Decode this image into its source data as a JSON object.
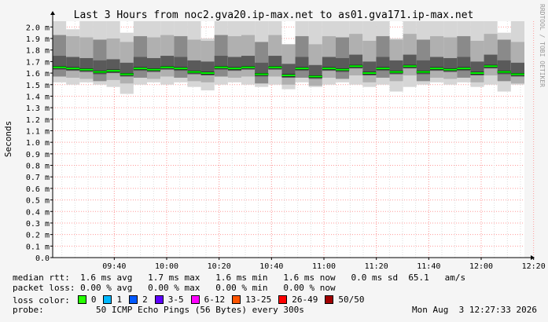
{
  "chart_data": {
    "type": "line",
    "title": "Last 3 Hours from noc2.gva20.ip-max.net to as01.gva171.ip-max.net",
    "ylabel": "Seconds",
    "xlabel": "",
    "watermark": "RRDTOOL / TOBI OETIKER",
    "ylim": [
      0,
      2.05
    ],
    "y_tick_labels": [
      "0.0",
      "0.1 m",
      "0.2 m",
      "0.3 m",
      "0.4 m",
      "0.5 m",
      "0.6 m",
      "0.7 m",
      "0.8 m",
      "0.9 m",
      "1.0 m",
      "1.1 m",
      "1.2 m",
      "1.3 m",
      "1.4 m",
      "1.5 m",
      "1.6 m",
      "1.7 m",
      "1.8 m",
      "1.9 m",
      "2.0 m"
    ],
    "x_tick_labels": [
      "09:40",
      "10:00",
      "10:20",
      "10:40",
      "11:00",
      "11:20",
      "11:40",
      "12:00",
      "12:20"
    ],
    "series": [
      {
        "name": "median rtt",
        "color": "#00ff00",
        "values": [
          1.65,
          1.64,
          1.63,
          1.61,
          1.62,
          1.59,
          1.64,
          1.63,
          1.65,
          1.64,
          1.61,
          1.6,
          1.65,
          1.64,
          1.65,
          1.59,
          1.65,
          1.58,
          1.64,
          1.57,
          1.64,
          1.63,
          1.66,
          1.6,
          1.64,
          1.61,
          1.66,
          1.61,
          1.64,
          1.63,
          1.64,
          1.6,
          1.66,
          1.61,
          1.59
        ]
      }
    ],
    "smoke_max": [
      2.05,
      1.98,
      2.05,
      2.05,
      2.05,
      1.95,
      2.05,
      2.05,
      2.05,
      2.05,
      2.05,
      1.9,
      2.05,
      2.05,
      2.05,
      2.05,
      2.05,
      1.85,
      2.05,
      2.05,
      2.05,
      2.05,
      2.05,
      2.05,
      2.05,
      1.9,
      2.05,
      2.05,
      2.05,
      2.05,
      2.05,
      2.05,
      2.05,
      1.95,
      2.05
    ],
    "smoke_min": [
      1.52,
      1.5,
      1.52,
      1.5,
      1.48,
      1.42,
      1.5,
      1.52,
      1.5,
      1.52,
      1.48,
      1.45,
      1.5,
      1.52,
      1.5,
      1.48,
      1.5,
      1.46,
      1.52,
      1.48,
      1.5,
      1.52,
      1.5,
      1.48,
      1.5,
      1.44,
      1.48,
      1.5,
      1.52,
      1.5,
      1.52,
      1.48,
      1.5,
      1.44,
      1.5
    ],
    "smoke_color": "#999999",
    "plot_background": "#ffffff",
    "grid_color": "#ff9999"
  },
  "stats": {
    "median_rtt": "median rtt:  1.6 ms avg   1.7 ms max   1.6 ms min   1.6 ms now   0.0 ms sd  65.1   am/s",
    "packet_loss": "packet loss: 0.00 % avg   0.00 % max   0.00 % min   0.00 % now"
  },
  "legend": {
    "label": "loss color:",
    "items": [
      {
        "label": "0",
        "color": "#26ff00"
      },
      {
        "label": "1",
        "color": "#00b8ff"
      },
      {
        "label": "2",
        "color": "#0059ff"
      },
      {
        "label": "3-5",
        "color": "#5e00ff"
      },
      {
        "label": "6-12",
        "color": "#ff00ff"
      },
      {
        "label": "13-25",
        "color": "#ff5500"
      },
      {
        "label": "26-49",
        "color": "#ff0000"
      },
      {
        "label": "50/50",
        "color": "#a10000"
      }
    ]
  },
  "probe": "probe:          50 ICMP Echo Pings (56 Bytes) every 300s",
  "timestamp": "Mon Aug  3 12:27:33 2026"
}
